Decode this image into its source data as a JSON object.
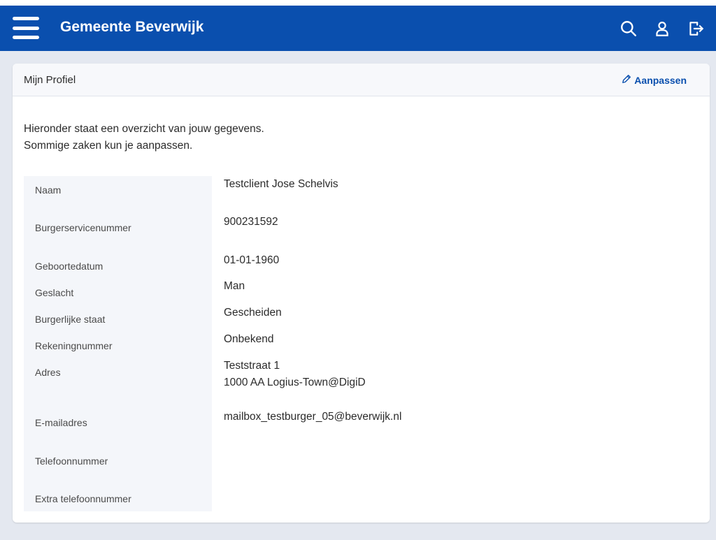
{
  "header": {
    "title": "Gemeente Beverwijk",
    "icons": [
      "menu-icon",
      "search-icon",
      "user-icon",
      "logout-icon"
    ],
    "color": "#0a4fae"
  },
  "profile": {
    "title": "Mijn Profiel",
    "edit_label": "Aanpassen",
    "intro_line1": "Hieronder staat een overzicht van jouw gegevens.",
    "intro_line2": "Sommige zaken kun je aanpassen.",
    "fields": {
      "naam": {
        "label": "Naam",
        "value": "Testclient Jose Schelvis"
      },
      "bsn": {
        "label": "Burgerservicenummer",
        "value": "900231592"
      },
      "geboortedatum": {
        "label": "Geboortedatum",
        "value": "01-01-1960"
      },
      "geslacht": {
        "label": "Geslacht",
        "value": "Man"
      },
      "burgerlijke_staat": {
        "label": "Burgerlijke staat",
        "value": "Gescheiden"
      },
      "rekeningnummer": {
        "label": "Rekeningnummer",
        "value": "Onbekend"
      },
      "adres": {
        "label": "Adres",
        "value_line1": "Teststraat 1",
        "value_line2": "1000 AA Logius-Town@DigiD"
      },
      "email": {
        "label": "E-mailadres",
        "value": "mailbox_testburger_05@beverwijk.nl"
      },
      "telefoon": {
        "label": "Telefoonnummer",
        "value": ""
      },
      "extra_telefoon": {
        "label": "Extra telefoonnummer",
        "value": ""
      }
    }
  }
}
